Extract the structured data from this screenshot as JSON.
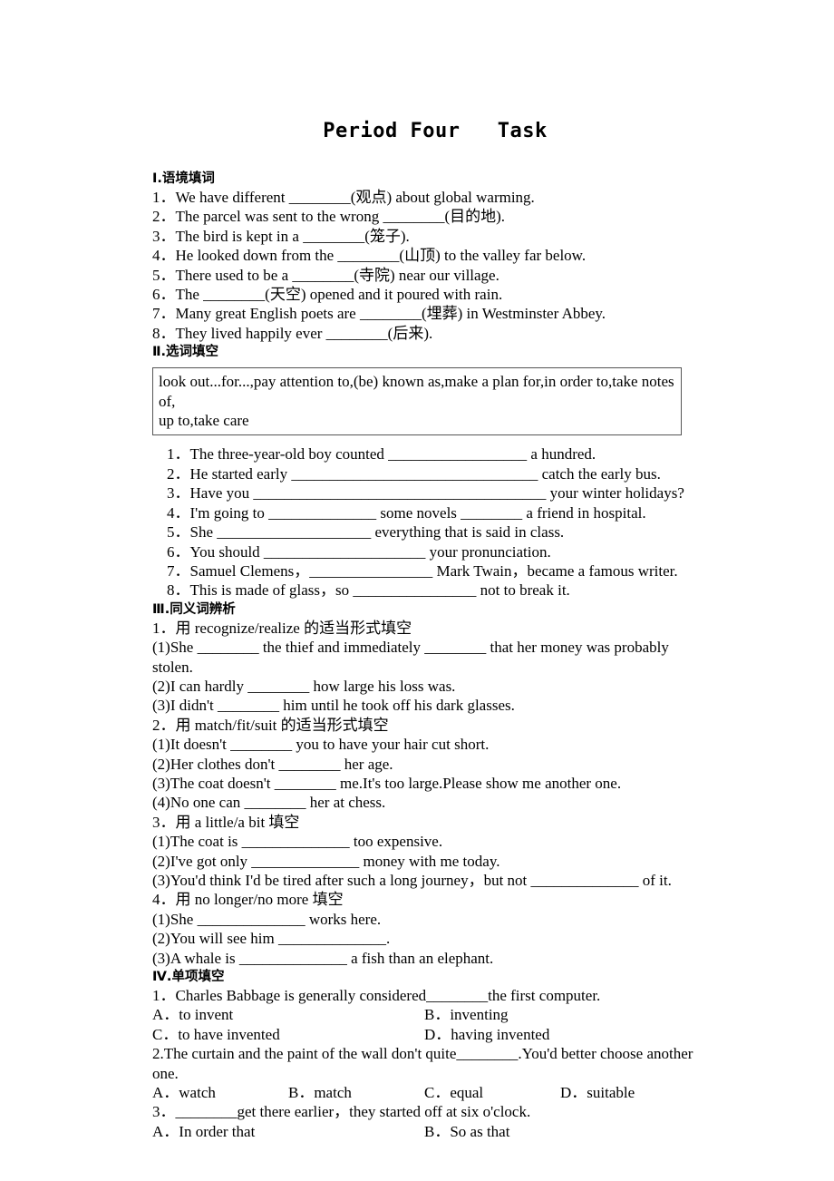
{
  "title": "Period Four   Task",
  "section1": {
    "heading": "Ⅰ.语境填词",
    "items": [
      "1．We have different ________(观点) about global warming.",
      "2．The parcel was sent to the wrong ________(目的地).",
      "3．The bird is kept in a ________(笼子).",
      "4．He looked down from the ________(山顶) to the valley far below.",
      "5．There used to be a ________(寺院) near our village.",
      "6．The ________(天空) opened and it poured with rain.",
      "7．Many great English poets are ________(埋葬) in Westminster Abbey.",
      "8．They lived happily ever ________(后来)."
    ]
  },
  "section2": {
    "heading": "Ⅱ.选词填空",
    "wordbank": "look out...for...,pay attention to,(be) known as,make a plan for,in order to,take notes of,\nup to,take care",
    "items": [
      "1．The three-year-old boy counted __________________ a hundred.",
      "2．He started early ________________________________ catch the early bus.",
      "3．Have you ______________________________________ your winter holidays?",
      "4．I'm going to ______________ some novels ________ a friend in hospital.",
      "5．She ____________________ everything that is said in class.",
      "6．You should _____________________ your pronunciation.",
      "7．Samuel Clemens，________________ Mark Twain，became a famous writer.",
      "8．This is made of glass，so ________________ not to break it."
    ]
  },
  "section3": {
    "heading": "Ⅲ.同义词辨析",
    "groups": [
      {
        "prompt": "1．用 recognize/realize 的适当形式填空",
        "items": [
          "(1)She ________ the thief and immediately ________ that her money was probably stolen.",
          "(2)I can hardly ________ how large his loss was.",
          "(3)I didn't ________ him until he took off his dark glasses."
        ]
      },
      {
        "prompt": "2．用 match/fit/suit 的适当形式填空",
        "items": [
          "(1)It doesn't ________ you to have your hair cut short.",
          "(2)Her clothes don't ________ her age.",
          "(3)The coat doesn't ________ me.It's too large.Please show me another one.",
          "(4)No one can ________ her at chess."
        ]
      },
      {
        "prompt": "3．用 a little/a bit 填空",
        "items": [
          "(1)The coat is ______________ too expensive.",
          "(2)I've got only ______________ money with me today.",
          "(3)You'd think I'd be tired after such a long journey，but not ______________ of it."
        ]
      },
      {
        "prompt": "4．用 no longer/no more 填空",
        "items": [
          "(1)She ______________ works here.",
          "(2)You will see him ______________.",
          "(3)A whale is ______________ a fish than an elephant."
        ]
      }
    ]
  },
  "section4": {
    "heading": "Ⅳ.单项填空",
    "questions": [
      {
        "stem": "1．Charles Babbage is generally considered________the first computer.",
        "layout": "two",
        "options": [
          "A．to invent",
          "B．inventing",
          "C．to have invented",
          "D．having invented"
        ]
      },
      {
        "stem": "2.The curtain and the paint of the wall don't quite________.You'd better choose another one.",
        "layout": "four",
        "options": [
          "A．watch",
          "B．match",
          "C．equal",
          "D．suitable"
        ]
      },
      {
        "stem": "3．________get there earlier，they started off at six o'clock.",
        "layout": "two",
        "options": [
          "A．In order that",
          "B．So as that"
        ]
      }
    ]
  }
}
